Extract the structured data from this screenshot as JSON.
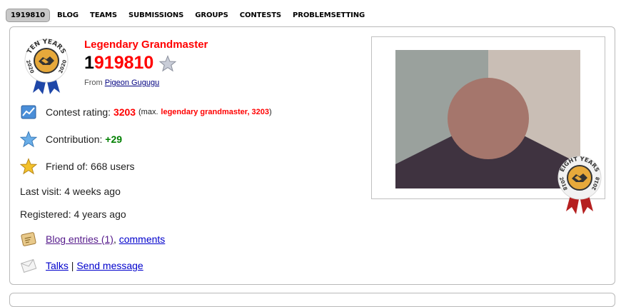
{
  "nav": {
    "items": [
      "1919810",
      "BLOG",
      "TEAMS",
      "SUBMISSIONS",
      "GROUPS",
      "CONTESTS",
      "PROBLEMSETTING"
    ],
    "active_index": 0
  },
  "profile": {
    "rank_title": "Legendary Grandmaster",
    "handle_first": "1",
    "handle_rest": "919810",
    "from_label": "From",
    "from_org": "Pigeon Gugugu",
    "badge_text": "TEN YEARS",
    "badge_year_left": "2020",
    "badge_year_right": "2020"
  },
  "stats": {
    "contest_rating_label": "Contest rating:",
    "contest_rating_value": "3203",
    "max_open": "(max.",
    "max_rank": "legendary grandmaster, 3203",
    "max_close": ")",
    "contribution_label": "Contribution:",
    "contribution_value": "+29",
    "friend_label": "Friend of:",
    "friend_value": "668 users",
    "last_visit_label": "Last visit:",
    "last_visit_value": "4 weeks ago",
    "registered_label": "Registered:",
    "registered_value": "4 years ago"
  },
  "links": {
    "blog_entries": "Blog entries (1)",
    "comma": ",",
    "comments": "comments",
    "talks": "Talks",
    "separator": "|",
    "send_message": "Send message"
  },
  "eight_badge": {
    "text": "EIGHT YEARS",
    "year_left": "2018",
    "year_right": "2018"
  },
  "colors": {
    "legendary": "#ff0000",
    "contribution": "#008000",
    "link_blue": "#0000cc",
    "link_visited": "#551a8b",
    "nav_active_bg": "#c8c8c8",
    "photo_bg_left": "#9aa19d",
    "photo_bg_right": "#c9beb5",
    "photo_face": "#a5766c",
    "photo_body": "#3f3340"
  },
  "icons": [
    "rating-chart-icon",
    "contribution-star-icon",
    "friend-star-icon",
    "blog-icon",
    "mail-icon",
    "handle-star-icon"
  ]
}
